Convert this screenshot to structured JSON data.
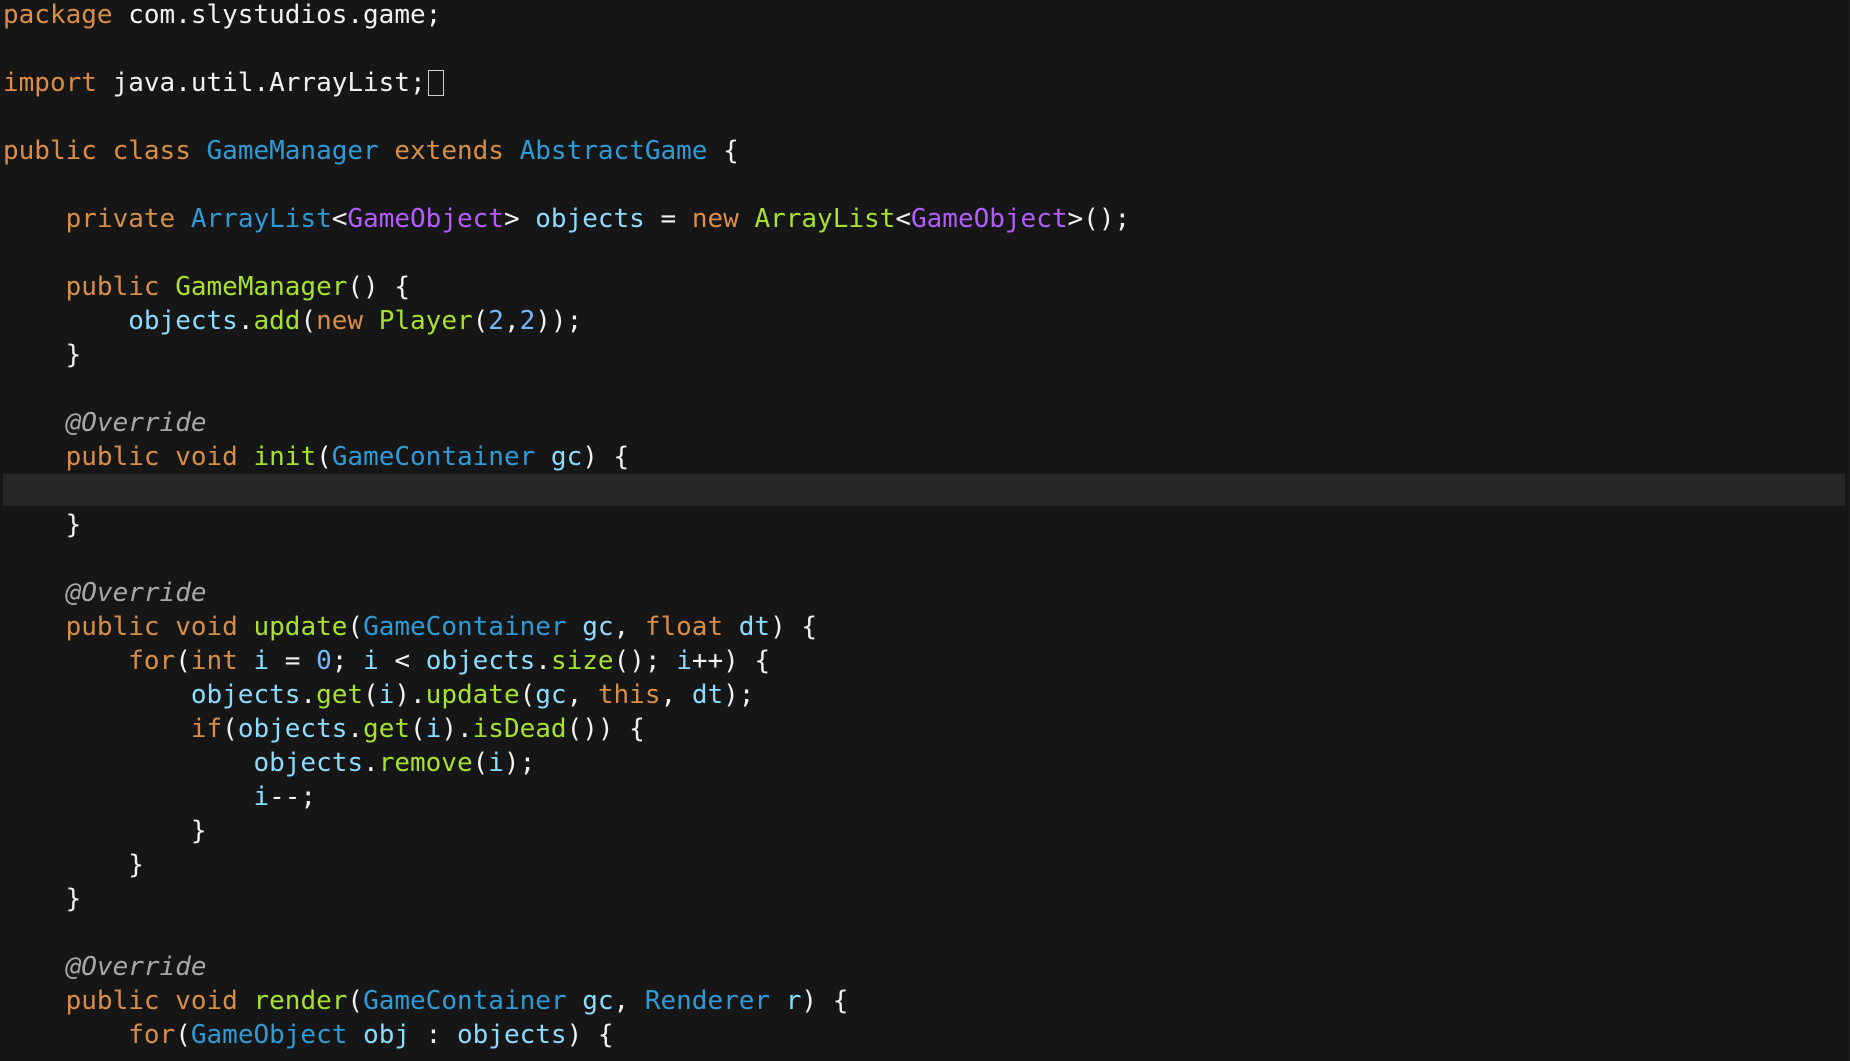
{
  "colors": {
    "background": "#161616",
    "current_line": "#272727",
    "keyword": "#d98e47",
    "type": "#2f9bd6",
    "function": "#a6e22e",
    "variable": "#8bdcff",
    "generic": "#b45cff",
    "number": "#79b8ff",
    "annotation": "#a8a8a8",
    "text": "#f2f2f2"
  },
  "editor": {
    "current_line_index": 14,
    "lines": [
      [
        {
          "t": "package",
          "c": "kw"
        },
        {
          "t": " com.slystudios.game;",
          "c": "txt"
        }
      ],
      [],
      [
        {
          "t": "import",
          "c": "kw"
        },
        {
          "t": " java.util.ArrayList;",
          "c": "txt"
        },
        {
          "t": "",
          "c": "cursor"
        }
      ],
      [],
      [
        {
          "t": "public",
          "c": "kw"
        },
        {
          "t": " ",
          "c": "txt"
        },
        {
          "t": "class",
          "c": "kw"
        },
        {
          "t": " ",
          "c": "txt"
        },
        {
          "t": "GameManager",
          "c": "type"
        },
        {
          "t": " ",
          "c": "txt"
        },
        {
          "t": "extends",
          "c": "kw"
        },
        {
          "t": " ",
          "c": "txt"
        },
        {
          "t": "AbstractGame",
          "c": "type"
        },
        {
          "t": " {",
          "c": "txt"
        }
      ],
      [],
      [
        {
          "t": "    ",
          "c": "txt"
        },
        {
          "t": "private",
          "c": "kw"
        },
        {
          "t": " ",
          "c": "txt"
        },
        {
          "t": "ArrayList",
          "c": "type"
        },
        {
          "t": "<",
          "c": "txt"
        },
        {
          "t": "GameObject",
          "c": "gen"
        },
        {
          "t": "> ",
          "c": "txt"
        },
        {
          "t": "objects",
          "c": "var"
        },
        {
          "t": " = ",
          "c": "txt"
        },
        {
          "t": "new",
          "c": "kw"
        },
        {
          "t": " ",
          "c": "txt"
        },
        {
          "t": "ArrayList",
          "c": "fn"
        },
        {
          "t": "<",
          "c": "txt"
        },
        {
          "t": "GameObject",
          "c": "gen"
        },
        {
          "t": ">();",
          "c": "txt"
        }
      ],
      [],
      [
        {
          "t": "    ",
          "c": "txt"
        },
        {
          "t": "public",
          "c": "kw"
        },
        {
          "t": " ",
          "c": "txt"
        },
        {
          "t": "GameManager",
          "c": "fn"
        },
        {
          "t": "() {",
          "c": "txt"
        }
      ],
      [
        {
          "t": "        ",
          "c": "txt"
        },
        {
          "t": "objects",
          "c": "var"
        },
        {
          "t": ".",
          "c": "txt"
        },
        {
          "t": "add",
          "c": "fn"
        },
        {
          "t": "(",
          "c": "txt"
        },
        {
          "t": "new",
          "c": "kw"
        },
        {
          "t": " ",
          "c": "txt"
        },
        {
          "t": "Player",
          "c": "fn"
        },
        {
          "t": "(",
          "c": "txt"
        },
        {
          "t": "2",
          "c": "num"
        },
        {
          "t": ",",
          "c": "txt"
        },
        {
          "t": "2",
          "c": "num"
        },
        {
          "t": "));",
          "c": "txt"
        }
      ],
      [
        {
          "t": "    }",
          "c": "txt"
        }
      ],
      [],
      [
        {
          "t": "    ",
          "c": "txt"
        },
        {
          "t": "@Override",
          "c": "ann"
        }
      ],
      [
        {
          "t": "    ",
          "c": "txt"
        },
        {
          "t": "public",
          "c": "kw"
        },
        {
          "t": " ",
          "c": "txt"
        },
        {
          "t": "void",
          "c": "kw"
        },
        {
          "t": " ",
          "c": "txt"
        },
        {
          "t": "init",
          "c": "fn"
        },
        {
          "t": "(",
          "c": "txt"
        },
        {
          "t": "GameContainer",
          "c": "type"
        },
        {
          "t": " ",
          "c": "txt"
        },
        {
          "t": "gc",
          "c": "var"
        },
        {
          "t": ") {",
          "c": "txt"
        }
      ],
      [],
      [
        {
          "t": "    }",
          "c": "txt"
        }
      ],
      [],
      [
        {
          "t": "    ",
          "c": "txt"
        },
        {
          "t": "@Override",
          "c": "ann"
        }
      ],
      [
        {
          "t": "    ",
          "c": "txt"
        },
        {
          "t": "public",
          "c": "kw"
        },
        {
          "t": " ",
          "c": "txt"
        },
        {
          "t": "void",
          "c": "kw"
        },
        {
          "t": " ",
          "c": "txt"
        },
        {
          "t": "update",
          "c": "fn"
        },
        {
          "t": "(",
          "c": "txt"
        },
        {
          "t": "GameContainer",
          "c": "type"
        },
        {
          "t": " ",
          "c": "txt"
        },
        {
          "t": "gc",
          "c": "var"
        },
        {
          "t": ", ",
          "c": "txt"
        },
        {
          "t": "float",
          "c": "kw"
        },
        {
          "t": " ",
          "c": "txt"
        },
        {
          "t": "dt",
          "c": "var"
        },
        {
          "t": ") {",
          "c": "txt"
        }
      ],
      [
        {
          "t": "        ",
          "c": "txt"
        },
        {
          "t": "for",
          "c": "kw"
        },
        {
          "t": "(",
          "c": "txt"
        },
        {
          "t": "int",
          "c": "kw"
        },
        {
          "t": " ",
          "c": "txt"
        },
        {
          "t": "i",
          "c": "var"
        },
        {
          "t": " = ",
          "c": "txt"
        },
        {
          "t": "0",
          "c": "num"
        },
        {
          "t": "; ",
          "c": "txt"
        },
        {
          "t": "i",
          "c": "var"
        },
        {
          "t": " < ",
          "c": "txt"
        },
        {
          "t": "objects",
          "c": "var"
        },
        {
          "t": ".",
          "c": "txt"
        },
        {
          "t": "size",
          "c": "fn"
        },
        {
          "t": "(); ",
          "c": "txt"
        },
        {
          "t": "i",
          "c": "var"
        },
        {
          "t": "++) {",
          "c": "txt"
        }
      ],
      [
        {
          "t": "            ",
          "c": "txt"
        },
        {
          "t": "objects",
          "c": "var"
        },
        {
          "t": ".",
          "c": "txt"
        },
        {
          "t": "get",
          "c": "fn"
        },
        {
          "t": "(",
          "c": "txt"
        },
        {
          "t": "i",
          "c": "var"
        },
        {
          "t": ").",
          "c": "txt"
        },
        {
          "t": "update",
          "c": "fn"
        },
        {
          "t": "(",
          "c": "txt"
        },
        {
          "t": "gc",
          "c": "var"
        },
        {
          "t": ", ",
          "c": "txt"
        },
        {
          "t": "this",
          "c": "kw"
        },
        {
          "t": ", ",
          "c": "txt"
        },
        {
          "t": "dt",
          "c": "var"
        },
        {
          "t": ");",
          "c": "txt"
        }
      ],
      [
        {
          "t": "            ",
          "c": "txt"
        },
        {
          "t": "if",
          "c": "kw"
        },
        {
          "t": "(",
          "c": "txt"
        },
        {
          "t": "objects",
          "c": "var"
        },
        {
          "t": ".",
          "c": "txt"
        },
        {
          "t": "get",
          "c": "fn"
        },
        {
          "t": "(",
          "c": "txt"
        },
        {
          "t": "i",
          "c": "var"
        },
        {
          "t": ").",
          "c": "txt"
        },
        {
          "t": "isDead",
          "c": "fn"
        },
        {
          "t": "()) {",
          "c": "txt"
        }
      ],
      [
        {
          "t": "                ",
          "c": "txt"
        },
        {
          "t": "objects",
          "c": "var"
        },
        {
          "t": ".",
          "c": "txt"
        },
        {
          "t": "remove",
          "c": "fn"
        },
        {
          "t": "(",
          "c": "txt"
        },
        {
          "t": "i",
          "c": "var"
        },
        {
          "t": ");",
          "c": "txt"
        }
      ],
      [
        {
          "t": "                ",
          "c": "txt"
        },
        {
          "t": "i",
          "c": "var"
        },
        {
          "t": "--;",
          "c": "txt"
        }
      ],
      [
        {
          "t": "            }",
          "c": "txt"
        }
      ],
      [
        {
          "t": "        }",
          "c": "txt"
        }
      ],
      [
        {
          "t": "    }",
          "c": "txt"
        }
      ],
      [],
      [
        {
          "t": "    ",
          "c": "txt"
        },
        {
          "t": "@Override",
          "c": "ann"
        }
      ],
      [
        {
          "t": "    ",
          "c": "txt"
        },
        {
          "t": "public",
          "c": "kw"
        },
        {
          "t": " ",
          "c": "txt"
        },
        {
          "t": "void",
          "c": "kw"
        },
        {
          "t": " ",
          "c": "txt"
        },
        {
          "t": "render",
          "c": "fn"
        },
        {
          "t": "(",
          "c": "txt"
        },
        {
          "t": "GameContainer",
          "c": "type"
        },
        {
          "t": " ",
          "c": "txt"
        },
        {
          "t": "gc",
          "c": "var"
        },
        {
          "t": ", ",
          "c": "txt"
        },
        {
          "t": "Renderer",
          "c": "type"
        },
        {
          "t": " ",
          "c": "txt"
        },
        {
          "t": "r",
          "c": "var"
        },
        {
          "t": ") {",
          "c": "txt"
        }
      ],
      [
        {
          "t": "        ",
          "c": "txt"
        },
        {
          "t": "for",
          "c": "kw"
        },
        {
          "t": "(",
          "c": "txt"
        },
        {
          "t": "GameObject",
          "c": "type"
        },
        {
          "t": " ",
          "c": "txt"
        },
        {
          "t": "obj",
          "c": "var"
        },
        {
          "t": " : ",
          "c": "txt"
        },
        {
          "t": "objects",
          "c": "var"
        },
        {
          "t": ") {",
          "c": "txt"
        }
      ]
    ]
  }
}
